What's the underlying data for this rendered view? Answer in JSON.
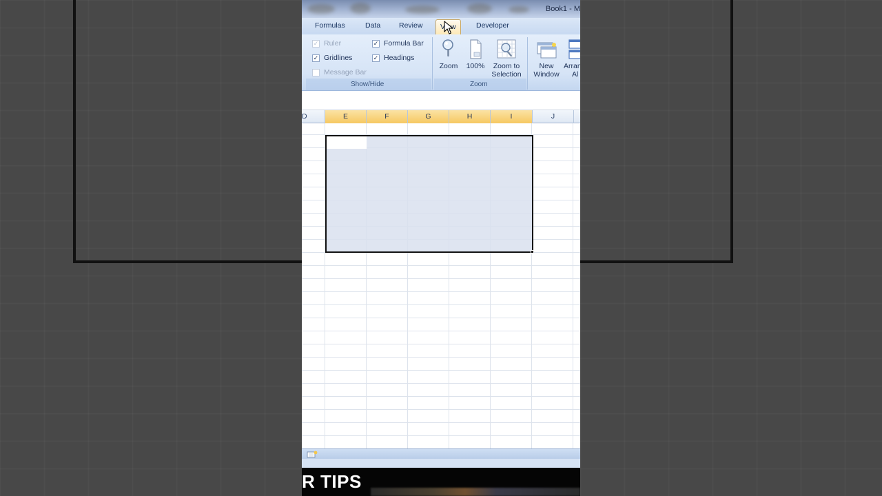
{
  "window": {
    "title": "Book1 - M"
  },
  "ribbon": {
    "tabs": [
      {
        "label": "Formulas",
        "active": false
      },
      {
        "label": "Data",
        "active": false
      },
      {
        "label": "Review",
        "active": false
      },
      {
        "label": "View",
        "active": true
      },
      {
        "label": "Developer",
        "active": false
      }
    ],
    "show_hide": {
      "label": "Show/Hide",
      "ruler": {
        "label": "Ruler",
        "checked": true,
        "enabled": false
      },
      "gridlines": {
        "label": "Gridlines",
        "checked": true,
        "enabled": true
      },
      "message_bar": {
        "label": "Message Bar",
        "checked": false,
        "enabled": false
      },
      "formula_bar": {
        "label": "Formula Bar",
        "checked": true,
        "enabled": true
      },
      "headings": {
        "label": "Headings",
        "checked": true,
        "enabled": true
      }
    },
    "zoom_group": {
      "label": "Zoom",
      "zoom_button": "Zoom",
      "hundred_button": "100%",
      "zoom_selection_line1": "Zoom to",
      "zoom_selection_line2": "Selection"
    },
    "window_group": {
      "new_window_line1": "New",
      "new_window_line2": "Window",
      "arrange_line1": "Arran",
      "arrange_line2": "Al"
    }
  },
  "sheet": {
    "columns": [
      {
        "label": "D",
        "selected": false
      },
      {
        "label": "E",
        "selected": true
      },
      {
        "label": "F",
        "selected": true
      },
      {
        "label": "G",
        "selected": true
      },
      {
        "label": "H",
        "selected": true
      },
      {
        "label": "I",
        "selected": true
      },
      {
        "label": "J",
        "selected": false
      }
    ]
  },
  "caption": {
    "text": "R TIPS"
  },
  "colors": {
    "selected_header": "#f6c862",
    "selection_fill": "#d9e1ee",
    "ribbon_bg": "#d6e4f6"
  }
}
